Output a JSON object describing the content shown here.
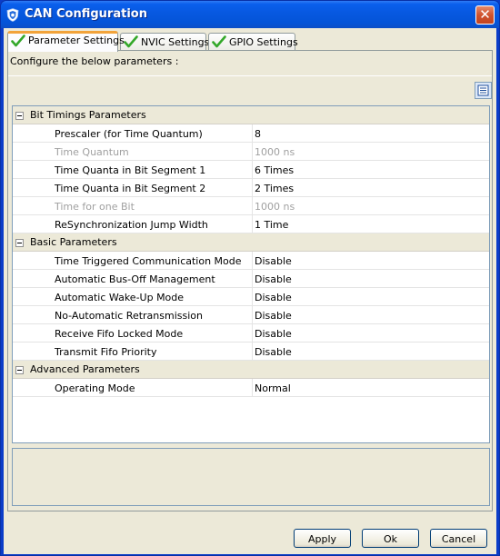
{
  "window": {
    "title": "CAN Configuration"
  },
  "tabs": [
    {
      "label": "Parameter Settings",
      "active": true
    },
    {
      "label": "NVIC Settings",
      "active": false
    },
    {
      "label": "GPIO Settings",
      "active": false
    }
  ],
  "panel": {
    "description": "Configure the below parameters :"
  },
  "groups": [
    {
      "label": "Bit Timings Parameters",
      "params": [
        {
          "name": "Prescaler (for Time Quantum)",
          "value": "8",
          "enabled": true
        },
        {
          "name": "Time Quantum",
          "value": "1000 ns",
          "enabled": false
        },
        {
          "name": "Time Quanta in Bit Segment 1",
          "value": "6 Times",
          "enabled": true
        },
        {
          "name": "Time Quanta in Bit Segment 2",
          "value": "2 Times",
          "enabled": true
        },
        {
          "name": "Time for one Bit",
          "value": "1000 ns",
          "enabled": false
        },
        {
          "name": "ReSynchronization Jump Width",
          "value": "1 Time",
          "enabled": true
        }
      ]
    },
    {
      "label": "Basic Parameters",
      "params": [
        {
          "name": "Time Triggered Communication Mode",
          "value": "Disable",
          "enabled": true
        },
        {
          "name": "Automatic Bus-Off Management",
          "value": "Disable",
          "enabled": true
        },
        {
          "name": "Automatic Wake-Up Mode",
          "value": "Disable",
          "enabled": true
        },
        {
          "name": "No-Automatic Retransmission",
          "value": "Disable",
          "enabled": true
        },
        {
          "name": "Receive Fifo Locked Mode",
          "value": "Disable",
          "enabled": true
        },
        {
          "name": "Transmit Fifo Priority",
          "value": "Disable",
          "enabled": true
        }
      ]
    },
    {
      "label": "Advanced Parameters",
      "params": [
        {
          "name": "Operating Mode",
          "value": "Normal",
          "enabled": true
        }
      ]
    }
  ],
  "buttons": {
    "apply": "Apply",
    "ok": "Ok",
    "cancel": "Cancel"
  },
  "icons": {
    "app": "shield-icon",
    "close": "close-icon",
    "tab_status": "check-icon",
    "view_toggle": "list-view-icon",
    "group_toggle": "collapse-icon"
  },
  "colors": {
    "titlebar": "#0758e0",
    "window_bg": "#ece9d8",
    "check": "#34a82a",
    "tab_highlight": "#f2a33a"
  }
}
